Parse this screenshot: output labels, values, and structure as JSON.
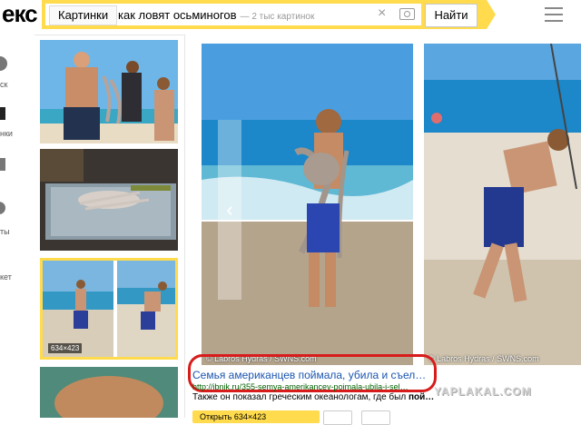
{
  "header": {
    "logo": "екс",
    "tag": "Картинки",
    "query": "как ловят осьминогов",
    "count": "— 2 тыс картинок",
    "find_label": "Найти",
    "clear_icon": "×"
  },
  "nav": {
    "items": [
      {
        "label": "ск"
      },
      {
        "label": "нки"
      },
      {
        "label": ""
      },
      {
        "label": "ты"
      },
      {
        "label": "кет"
      }
    ]
  },
  "thumbs": {
    "selected_size": "634×423"
  },
  "viewer": {
    "credit_main": "© Labros Hydras / SWNS.com",
    "credit_side": "© Labros Hydras / SWNS.com",
    "prev_arrow": "‹",
    "title": "Семья американцев поймала, убила и съел…",
    "url": "http://ibnik.ru/355-semya-amerikancev-poimala-ubila-i-sel…",
    "desc_text": "Также он показал греческим океанологам, где был ",
    "desc_bold": "пой…",
    "open_label": "Открыть 634×423"
  },
  "watermark": "YAPLAKAL.COM",
  "colors": {
    "accent": "#ffdb4d",
    "link": "#1a55b0",
    "url": "#006000",
    "highlight": "#d81c1c"
  }
}
